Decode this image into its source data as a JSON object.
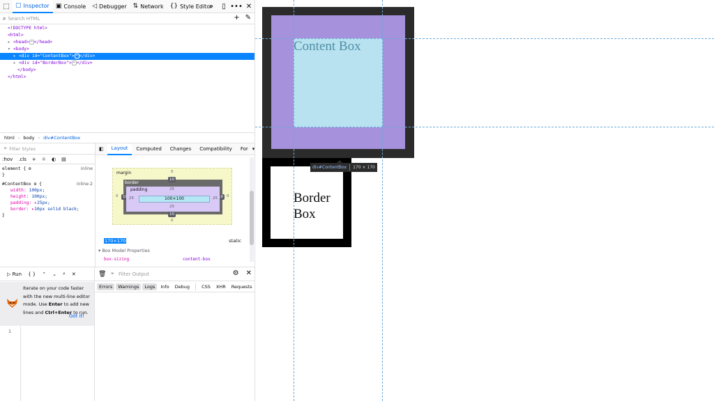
{
  "toolbar": {
    "tabs": [
      {
        "label": "Inspector",
        "icon": "inspector-icon"
      },
      {
        "label": "Console",
        "icon": "console-icon"
      },
      {
        "label": "Debugger",
        "icon": "debugger-icon"
      },
      {
        "label": "Network",
        "icon": "network-icon"
      },
      {
        "label": "Style Editor",
        "icon": "style-editor-icon"
      }
    ]
  },
  "search": {
    "placeholder": "Search HTML"
  },
  "tree": {
    "doctype": "<!DOCTYPE html>",
    "html_open": "<html>",
    "head": "<head>",
    "head_close": "</head>",
    "body_open": "<body>",
    "div1_open": "<div id=\"ContentBox\">",
    "div1_close": "</div>",
    "div2_open": "<div id=\"BorderBox\">",
    "div2_close": "</div>",
    "body_close": "</body>",
    "html_close": "</html>",
    "ellipsis": "⋯"
  },
  "breadcrumb": {
    "items": [
      "html",
      "body",
      "div#ContentBox"
    ]
  },
  "rules": {
    "filter_placeholder": "Filter Styles",
    "hov": ":hov",
    "cls": ".cls",
    "element_selector": "element {",
    "element_close": "}",
    "element_source": "inline",
    "contentbox_selector": "#ContentBox",
    "contentbox_brace": "{",
    "contentbox_source": "inline:2",
    "declarations": [
      {
        "prop": "width",
        "value": "100px;"
      },
      {
        "prop": "height",
        "value": "100px;"
      },
      {
        "prop": "padding",
        "value": "25px;"
      },
      {
        "prop": "border",
        "value": "10px solid black;"
      }
    ],
    "close": "}"
  },
  "layout": {
    "tabs": [
      "Layout",
      "Computed",
      "Changes",
      "Compatibility",
      "For"
    ],
    "box_model": {
      "margin_label": "margin",
      "border_label": "border",
      "padding_label": "padding",
      "margin_top": "0",
      "margin_bottom": "0",
      "margin_left": "0",
      "margin_right": "0",
      "border_top": "10",
      "border_bottom": "10",
      "border_left": "10",
      "border_right": "10",
      "padding_top": "25",
      "padding_bottom": "25",
      "padding_left": "25",
      "padding_right": "25",
      "content": "100×100"
    },
    "dimensions": "170×170",
    "position": "static",
    "properties_header": "Box Model Properties",
    "properties": [
      {
        "name": "box-sizing",
        "value": "content-box"
      }
    ]
  },
  "console": {
    "run_label": "Run",
    "braces": "{ }",
    "tip_text_parts": [
      "Iterate on your code faster with the new multi-line editor mode. Use ",
      "Enter",
      " to add new lines and ",
      "Ctrl+Enter",
      " to run."
    ],
    "got_it": "Got it!",
    "line_number": "1",
    "filter_placeholder": "Filter Output",
    "filters": [
      {
        "label": "Errors",
        "on": true
      },
      {
        "label": "Warnings",
        "on": true
      },
      {
        "label": "Logs",
        "on": true
      },
      {
        "label": "Info",
        "on": false
      },
      {
        "label": "Debug",
        "on": false
      },
      {
        "label": "CSS",
        "on": false
      },
      {
        "label": "XHR",
        "on": false
      },
      {
        "label": "Requests",
        "on": false
      }
    ]
  },
  "page": {
    "content_box_text": "Content Box",
    "border_box_line1": "Border",
    "border_box_line2": "Box",
    "infobar_tag": "div#ContentBox",
    "infobar_dims": "170 × 170"
  }
}
